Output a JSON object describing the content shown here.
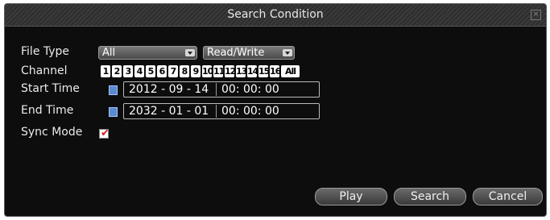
{
  "dialog": {
    "title": "Search Condition",
    "close_glyph": "×"
  },
  "labels": {
    "file_type": "File Type",
    "channel": "Channel",
    "start_time": "Start Time",
    "end_time": "End Time",
    "sync_mode": "Sync Mode"
  },
  "file_type": {
    "selected": "All"
  },
  "access_mode": {
    "selected": "Read/Write"
  },
  "channels": [
    "1",
    "2",
    "3",
    "4",
    "5",
    "6",
    "7",
    "8",
    "9",
    "10",
    "11",
    "12",
    "13",
    "14",
    "15",
    "16",
    "All"
  ],
  "start_time": {
    "date": "2012 - 09 - 14",
    "time": "00: 00: 00"
  },
  "end_time": {
    "date": "2032 - 01 - 01",
    "time": "00: 00: 00"
  },
  "sync_mode": {
    "checked": true,
    "check_glyph": "✔"
  },
  "buttons": {
    "play": "Play",
    "search": "Search",
    "cancel": "Cancel"
  },
  "icons": {
    "calendar": "calendar-icon",
    "close": "close-icon",
    "dropdown": "chevron-down-icon"
  }
}
